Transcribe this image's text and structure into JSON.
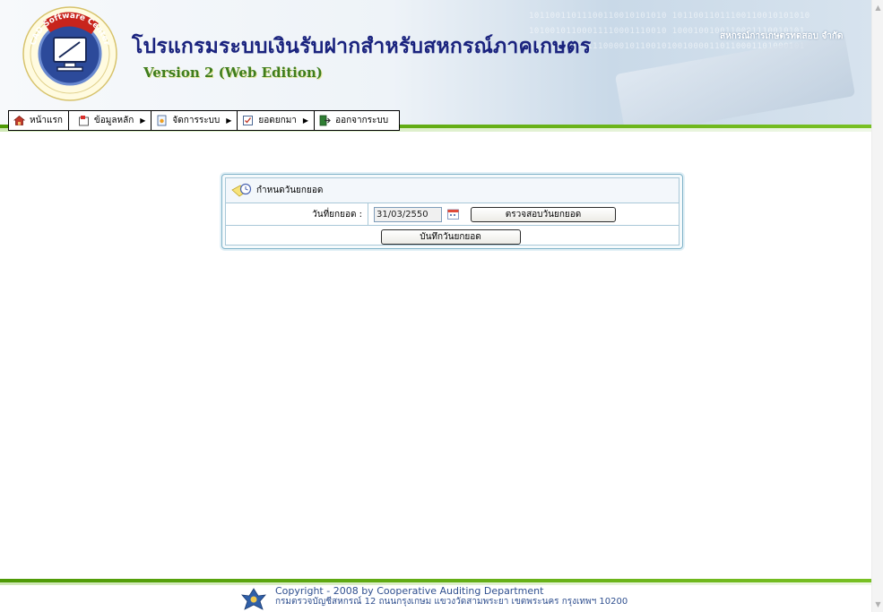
{
  "header": {
    "app_title": "โปรแกรมระบบเงินรับฝากสำหรับสหกรณ์ภาคเกษตร",
    "version": "Version 2 (Web Edition)",
    "org_name": "สหกรณ์การเกษตรทดสอบ จำกัด",
    "logo_text": "CAD Software Center",
    "binary_rows": [
      "10110011011100110010101010 10110011011100110010101010",
      "10100101100011110001110010 1000100100110001110010101",
      "1001001010011100001011001010010000110110001101000101"
    ]
  },
  "menu": {
    "items": [
      {
        "label": "หน้าแรก",
        "icon": "home-icon",
        "has_submenu": false
      },
      {
        "label": "ข้อมูลหลัก",
        "icon": "folder-icon",
        "has_submenu": true
      },
      {
        "label": "จัดการระบบ",
        "icon": "settings-page-icon",
        "has_submenu": true
      },
      {
        "label": "ยอดยกมา",
        "icon": "checklist-icon",
        "has_submenu": true
      },
      {
        "label": "ออกจากระบบ",
        "icon": "exit-icon",
        "has_submenu": false
      }
    ]
  },
  "panel": {
    "title": "กำหนดวันยกยอด",
    "date_label": "วันที่ยกยอด :",
    "date_value": "31/03/2550",
    "check_button": "ตรวจสอบวันยกยอด",
    "save_button": "บันทึกวันยกยอด"
  },
  "footer": {
    "copyright": "Copyright - 2008 by Cooperative Auditing Department",
    "address": "กรมตรวจบัญชีสหกรณ์ 12 ถนนกรุงเกษม แขวงวัดสามพระยา เขตพระนคร กรุงเทพฯ 10200"
  },
  "colors": {
    "title": "#1a237e",
    "version": "#3f7d1e",
    "accent_green": "#4e9a06",
    "panel_border": "#7fb2c8"
  }
}
